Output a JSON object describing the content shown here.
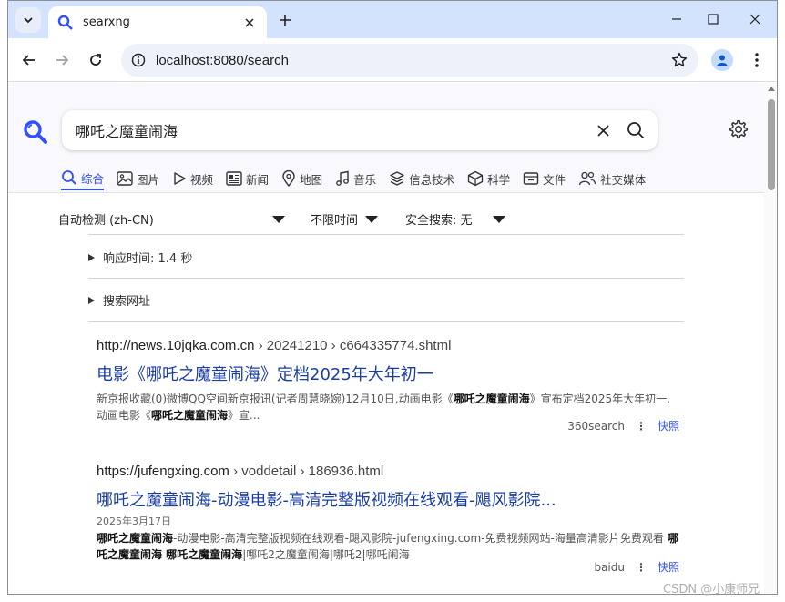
{
  "browser": {
    "tab_title": "searxng",
    "url": "localhost:8080/search"
  },
  "search": {
    "query": "哪吒之魔童闹海"
  },
  "categories": [
    {
      "label": "综合",
      "icon": "search-icon",
      "active": true
    },
    {
      "label": "图片",
      "icon": "image-icon"
    },
    {
      "label": "视频",
      "icon": "play-icon"
    },
    {
      "label": "新闻",
      "icon": "newspaper-icon"
    },
    {
      "label": "地图",
      "icon": "map-pin-icon"
    },
    {
      "label": "音乐",
      "icon": "music-icon"
    },
    {
      "label": "信息技术",
      "icon": "layers-icon"
    },
    {
      "label": "科学",
      "icon": "cube-icon"
    },
    {
      "label": "文件",
      "icon": "file-box-icon"
    },
    {
      "label": "社交媒体",
      "icon": "people-icon"
    }
  ],
  "filters": {
    "language": "自动检测 (zh-CN)",
    "time": "不限时间",
    "safe_search": "安全搜索: 无"
  },
  "info": {
    "response_time": "响应时间: 1.4 秒",
    "search_url": "搜索网址"
  },
  "results": [
    {
      "url_host": "http://news.10jqka.com.cn",
      "url_path": "› 20241210 › c664335774.shtml",
      "title": "电影《哪吒之魔童闹海》定档2025年大年初一",
      "date": "",
      "snippet_parts": [
        "新京报收藏(0)微博QQ空间新京报讯(记者周慧晓婉)12月10日,动画电影《",
        "哪吒之魔童闹海",
        "》宣布定档2025年大年初一.动画电影《",
        "哪吒之魔童闹海",
        "》宣..."
      ],
      "engine": "360search",
      "cache": "快照"
    },
    {
      "url_host": "https://jufengxing.com",
      "url_path": "› voddetail › 186936.html",
      "title": "哪吒之魔童闹海-动漫电影-高清完整版视频在线观看-飓风影院...",
      "date": "2025年3月17日",
      "snippet_parts": [
        "",
        "哪吒之魔童闹海",
        "-动漫电影-高清完整版视频在线观看-飓风影院-jufengxing.com-免费视频网站-海量高清影片免费观看 ",
        "哪吒之魔童闹海 哪吒之魔童闹海",
        "|哪吒2之魔童闹海|哪吒2|哪吒闹海"
      ],
      "engine": "baidu",
      "cache": "快照"
    }
  ],
  "watermark": "CSDN @小康师兄",
  "colors": {
    "accent": "#3050ff",
    "link": "#1a3ea8",
    "tabstrip": "#d3e3fd"
  }
}
